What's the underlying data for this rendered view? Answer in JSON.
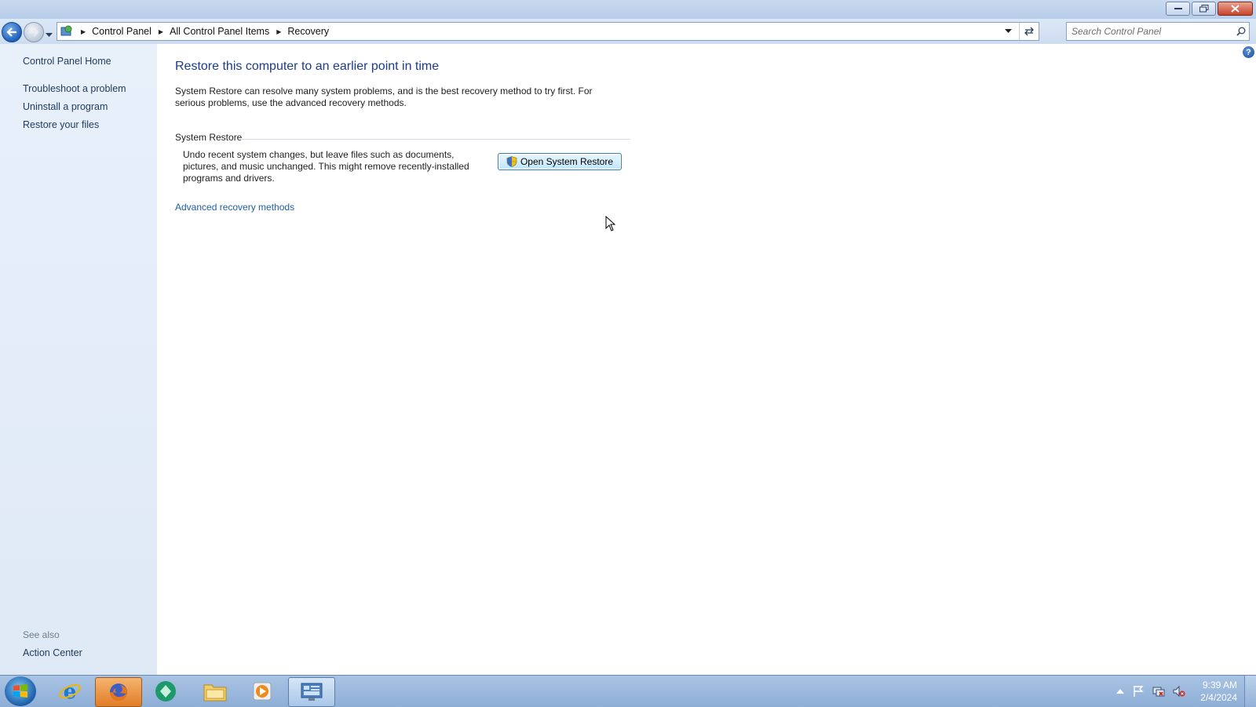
{
  "window": {
    "controls": {
      "minimize": "minimize",
      "maximize": "restore",
      "close": "close"
    }
  },
  "address": {
    "breadcrumbs": [
      "Control Panel",
      "All Control Panel Items",
      "Recovery"
    ]
  },
  "search": {
    "placeholder": "Search Control Panel"
  },
  "sidebar": {
    "home": "Control Panel Home",
    "links": [
      "Troubleshoot a problem",
      "Uninstall a program",
      "Restore your files"
    ],
    "see_also_label": "See also",
    "see_also_links": [
      "Action Center"
    ]
  },
  "main": {
    "title": "Restore this computer to an earlier point in time",
    "intro": "System Restore can resolve many system problems, and is the best recovery method to try first. For serious problems, use the advanced recovery methods.",
    "section": {
      "label": "System Restore",
      "description": "Undo recent system changes, but leave files such as documents, pictures, and music unchanged. This might remove recently-installed programs and drivers.",
      "button": "Open System Restore"
    },
    "advanced_link": "Advanced recovery methods"
  },
  "taskbar": {
    "items": [
      "start-orb",
      "internet-explorer",
      "firefox",
      "app-green-circle",
      "windows-explorer",
      "media-player",
      "control-panel"
    ],
    "active_item": "control-panel",
    "clock_time": "9:39 AM",
    "clock_date": "2/4/2024"
  },
  "colors": {
    "title_blue": "#1e3c8c",
    "link_blue": "#1e5ea8",
    "sidebar_bg": "#e4edf8",
    "taskbar_bg": "#9cb8dc"
  }
}
